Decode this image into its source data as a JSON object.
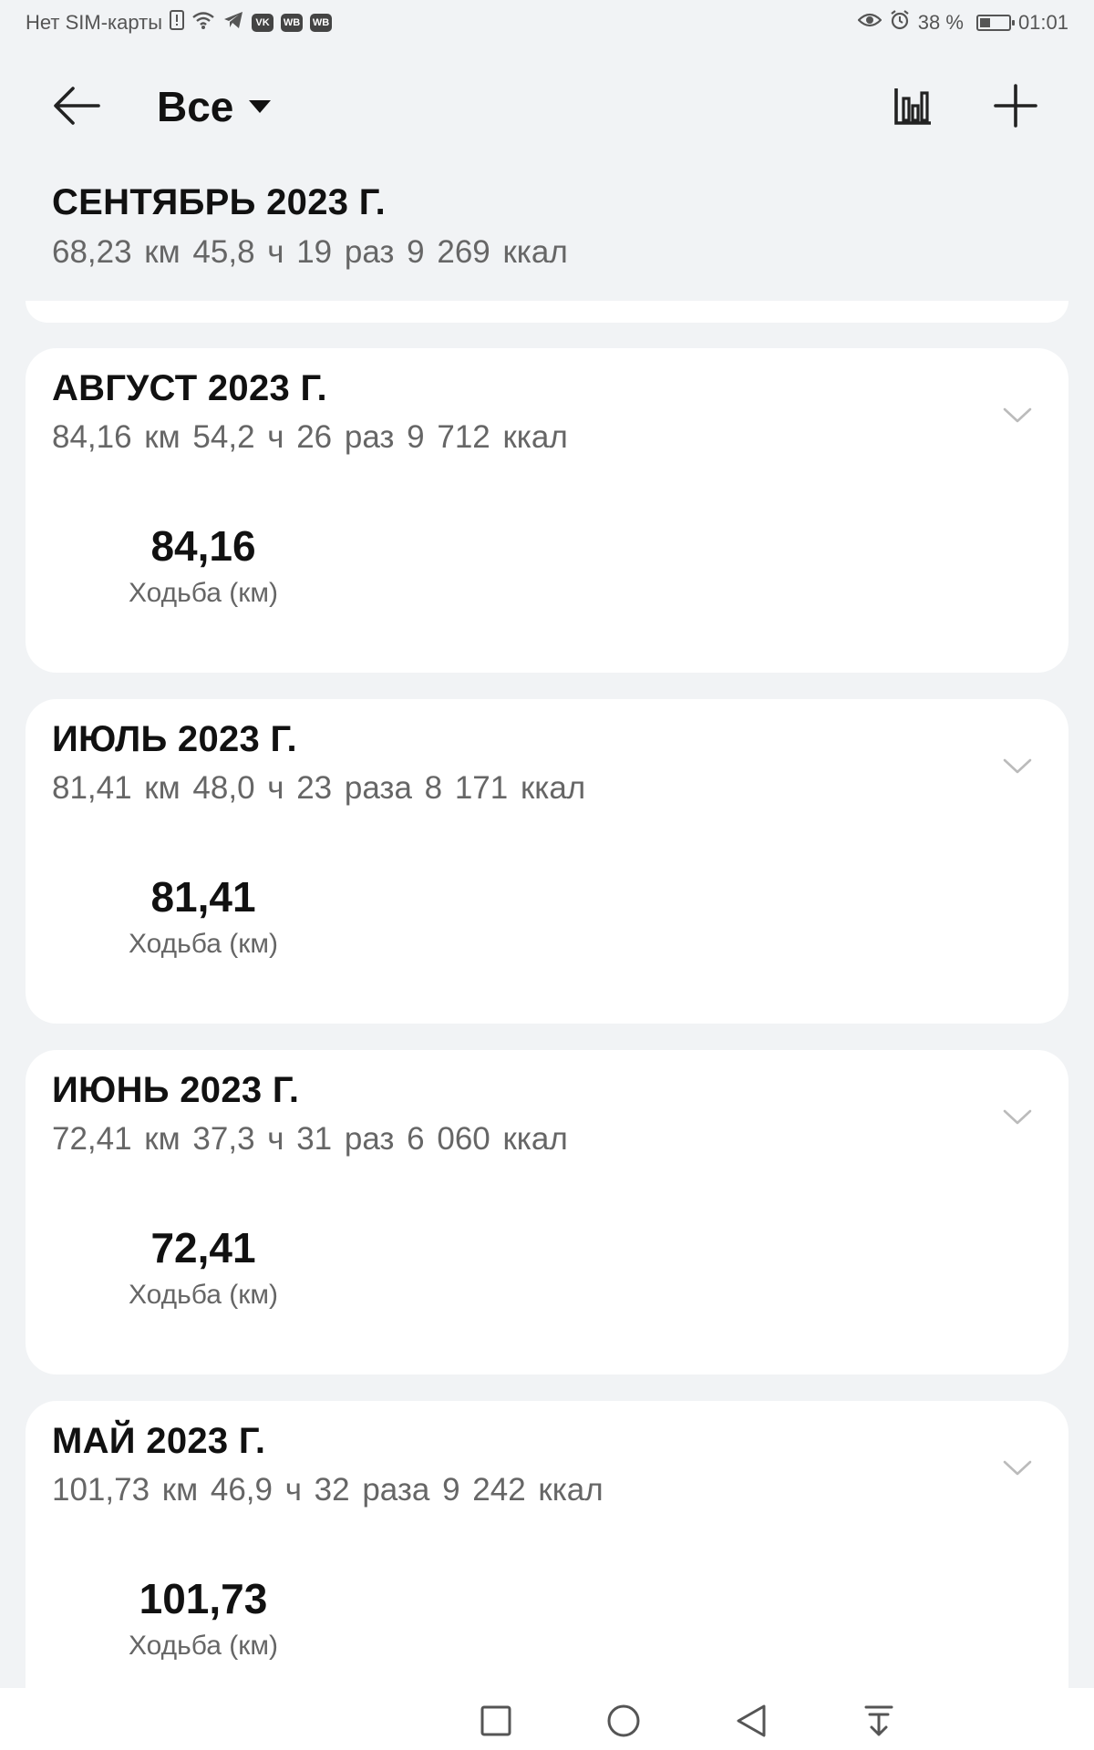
{
  "status_bar": {
    "carrier": "Нет SIM-карты",
    "badge_1": "VK",
    "badge_2": "WB",
    "badge_3": "WB",
    "battery": "38 %",
    "battery_level": 0.38,
    "time": "01:01"
  },
  "header": {
    "filter_label": "Все",
    "icons": [
      "back-arrow-icon",
      "dropdown-caret-icon",
      "bar-chart-icon",
      "plus-icon"
    ]
  },
  "months": [
    {
      "title": "СЕНТЯБРЬ 2023 Г.",
      "summary": "68,23 км  45,8 ч  19 раз  9 269 ккал"
    },
    {
      "title": "АВГУСТ 2023 Г.",
      "summary": "84,16 км  54,2 ч  26 раз  9 712 ккал",
      "value": "84,16",
      "label": "Ходьба (км)"
    },
    {
      "title": "ИЮЛЬ 2023 Г.",
      "summary": "81,41 км  48,0 ч  23 раза  8 171 ккал",
      "value": "81,41",
      "label": "Ходьба (км)"
    },
    {
      "title": "ИЮНЬ 2023 Г.",
      "summary": "72,41 км  37,3 ч  31 раз  6 060 ккал",
      "value": "72,41",
      "label": "Ходьба (км)"
    },
    {
      "title": "МАЙ 2023 Г.",
      "summary": "101,73 км  46,9 ч  32 раза  9 242 ккал",
      "value": "101,73",
      "label": "Ходьба (км)"
    }
  ],
  "nav": {
    "icons": [
      "recents-square-icon",
      "home-circle-icon",
      "back-triangle-icon",
      "notification-pull-icon"
    ]
  },
  "colors": {
    "background": "#f1f3f5",
    "card": "#ffffff",
    "text_primary": "#111111",
    "text_secondary": "#666666"
  }
}
